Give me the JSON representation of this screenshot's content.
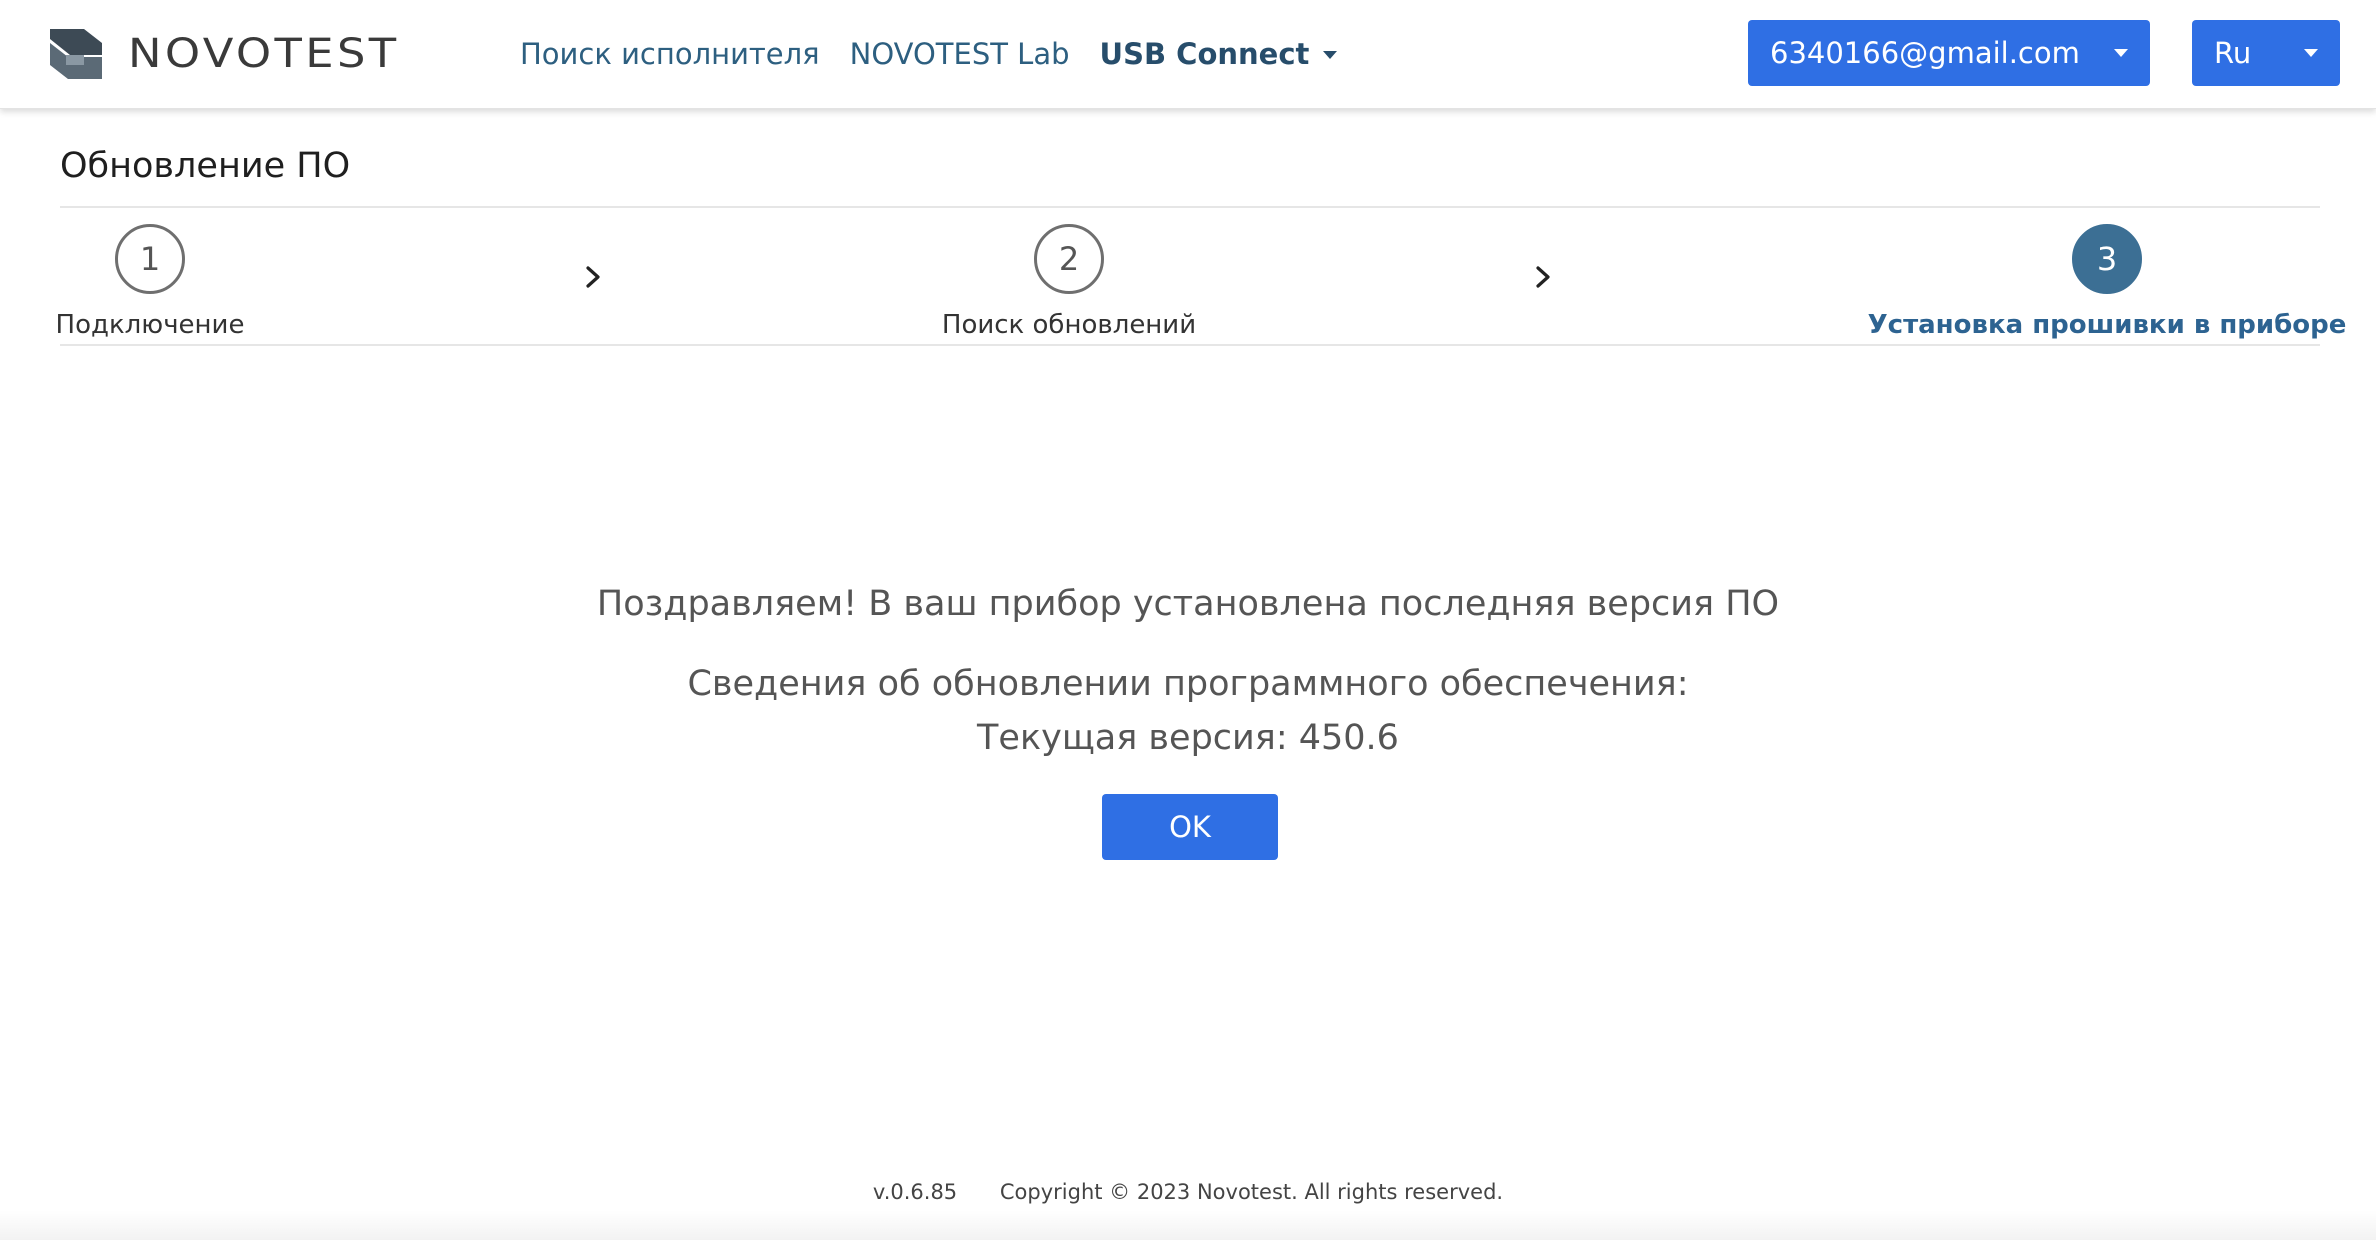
{
  "header": {
    "logo_text": "NOVOTEST",
    "nav": [
      {
        "label": "Поиск исполнителя"
      },
      {
        "label": "NOVOTEST Lab"
      },
      {
        "label": "USB Connect"
      }
    ],
    "user_email": "6340166@gmail.com",
    "language": "Ru"
  },
  "page": {
    "title": "Обновление ПО"
  },
  "steps": [
    {
      "number": "1",
      "label": "Подключение"
    },
    {
      "number": "2",
      "label": "Поиск обновлений"
    },
    {
      "number": "3",
      "label": "Установка прошивки в приборе"
    }
  ],
  "message": {
    "congrats": "Поздравляем! В ваш прибор установлена последняя версия ПО",
    "info": "Сведения об обновлении программного обеспечения:",
    "version": "Текущая версия: 450.6",
    "ok_label": "OK"
  },
  "footer": {
    "version": "v.0.6.85",
    "copyright": "Copyright © 2023 Novotest.  All rights reserved."
  },
  "colors": {
    "primary_button": "#2f6fe4",
    "active_step": "#3c6f94",
    "nav_link": "#2d5f80"
  },
  "icons": {
    "logo": "novotest-logo-icon",
    "dropdown": "caret-down-icon",
    "step_separator": "chevron-right-icon"
  }
}
